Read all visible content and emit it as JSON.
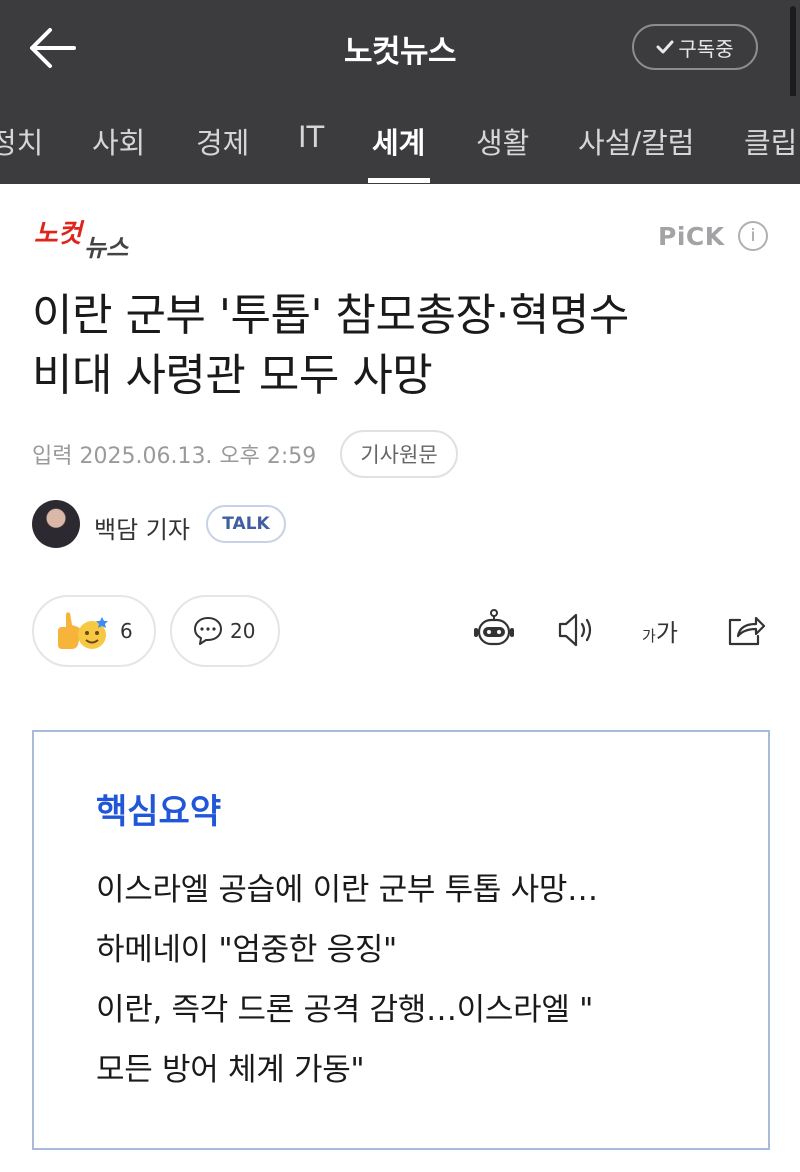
{
  "header": {
    "title": "노컷뉴스",
    "subscribe_label": "구독중"
  },
  "tabs": [
    {
      "label": "정치"
    },
    {
      "label": "사회"
    },
    {
      "label": "경제"
    },
    {
      "label": "IT"
    },
    {
      "label": "세계",
      "active": true
    },
    {
      "label": "생활"
    },
    {
      "label": "사설/칼럼"
    },
    {
      "label": "클립"
    }
  ],
  "article": {
    "press_logo_text": "노컷뉴스",
    "pick_label": "PiCK",
    "info_glyph": "i",
    "headline_line1": "이란 군부 '투톱' 참모총장·혁명수",
    "headline_line2": "비대 사령관 모두 사망",
    "date": "입력 2025.06.13. 오후 2:59",
    "original_label": "기사원문",
    "reporter": "백담 기자",
    "talk_label": "TALK"
  },
  "actions": {
    "reaction_count": "6",
    "comment_count": "20",
    "font_size_small": "가",
    "font_size_large": "가"
  },
  "summary": {
    "title": "핵심요약",
    "lines": [
      "이스라엘 공습에 이란 군부 투톱 사망…",
      "하메네이 \"엄중한 응징\"",
      "이란, 즉각 드론 공격 감행…이스라엘 \"",
      "모든 방어 체계 가동\""
    ]
  },
  "colors": {
    "header_bg": "#3c3c3f",
    "summary_title": "#2156d8",
    "summary_border": "#aabadb",
    "logo_red": "#e0231b"
  }
}
